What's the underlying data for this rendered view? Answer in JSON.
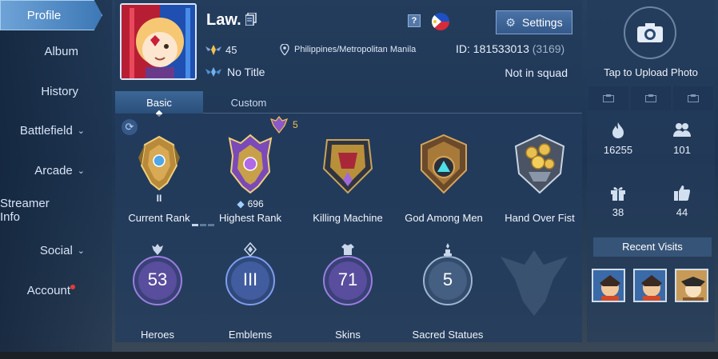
{
  "nav": {
    "items": [
      {
        "label": "Profile",
        "active": true,
        "chevron": false
      },
      {
        "label": "Album",
        "active": false,
        "chevron": false
      },
      {
        "label": "History",
        "active": false,
        "chevron": false
      },
      {
        "label": "Battlefield",
        "active": false,
        "chevron": true
      },
      {
        "label": "Arcade",
        "active": false,
        "chevron": true
      },
      {
        "label": "Streamer Info",
        "active": false,
        "chevron": false
      },
      {
        "label": "Social",
        "active": false,
        "chevron": true
      },
      {
        "label": "Account",
        "active": false,
        "chevron": false,
        "notification": true
      }
    ],
    "chevron_glyph": "⌄"
  },
  "profile": {
    "username": "Law.",
    "level": "45",
    "location": "Philippines/Metropolitan Manila",
    "id_label": "ID:",
    "id_value": "181533013",
    "server": "(3169)",
    "title": "No Title",
    "squad": "Not in squad",
    "help_label": "?",
    "settings_label": "Settings"
  },
  "tabs": [
    {
      "label": "Basic",
      "active": true
    },
    {
      "label": "Custom",
      "active": false
    }
  ],
  "badge_count": "5",
  "medals": [
    {
      "label": "Current Rank",
      "sub": "II",
      "kind": "rank-gold"
    },
    {
      "label": "Highest Rank",
      "sub": "696",
      "kind": "rank-mythic"
    },
    {
      "label": "Killing Machine",
      "kind": "achievement"
    },
    {
      "label": "God Among Men",
      "kind": "achievement"
    },
    {
      "label": "Hand Over Fist",
      "kind": "achievement"
    }
  ],
  "stats": [
    {
      "label": "Heroes",
      "value": "53",
      "color": "#b48cf0"
    },
    {
      "label": "Emblems",
      "value": "III",
      "color": "#7f9df0"
    },
    {
      "label": "Skins",
      "value": "71",
      "color": "#b48cf0"
    },
    {
      "label": "Sacred Statues",
      "value": "5",
      "color": "#9fb6d2"
    }
  ],
  "right": {
    "upload_label": "Tap to Upload Photo",
    "popularity": "16255",
    "followers": "101",
    "gifts": "38",
    "likes": "44",
    "recent_title": "Recent Visits"
  },
  "colors": {
    "accent": "#3d78b6",
    "gold": "#f2c14e",
    "notification": "#e53a3a"
  }
}
